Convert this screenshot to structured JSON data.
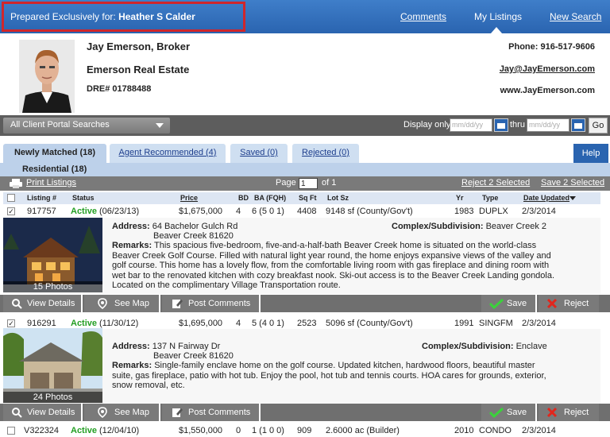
{
  "top": {
    "prepared_label": "Prepared Exclusively for:",
    "client_name": "Heather S Calder",
    "nav": [
      "Comments",
      "My Listings",
      "New Search"
    ]
  },
  "agent": {
    "name": "Jay Emerson, Broker",
    "company": "Emerson Real Estate",
    "dre": "DRE# 01788488",
    "phone": "Phone: 916-517-9606",
    "email": "Jay@JayEmerson.com",
    "website": "www.JayEmerson.com"
  },
  "search": {
    "portal_select": "All Client Portal Searches",
    "display_only_label": "Display only",
    "thru_label": "thru",
    "date_placeholder": "mm/dd/yy",
    "go_label": "Go"
  },
  "tabs": [
    {
      "label": "Newly Matched (18)",
      "active": true
    },
    {
      "label": "Agent Recommended (4)",
      "active": false
    },
    {
      "label": "Saved (0)",
      "active": false
    },
    {
      "label": "Rejected (0)",
      "active": false
    }
  ],
  "help_label": "Help",
  "section_title": "Residential (18)",
  "toolbar": {
    "print_label": "Print Listings",
    "page_label": "Page",
    "page_value": "1",
    "of_label": "of 1",
    "reject_selected": "Reject 2 Selected",
    "save_selected": "Save 2 Selected"
  },
  "columns": [
    "Listing #",
    "Status",
    "Price",
    "BD",
    "BA (FQH)",
    "Sq Ft",
    "Lot Sz",
    "Yr",
    "Type",
    "Date Updated"
  ],
  "listings": [
    {
      "checked": true,
      "listing_no": "917757",
      "status": "Active",
      "status_date": "(06/23/13)",
      "price": "$1,675,000",
      "bd": "4",
      "ba": "6 (5 0 1)",
      "sqft": "4408",
      "lot": "9148 sf (County/Gov't)",
      "yr": "1983",
      "type": "DUPLX",
      "updated": "2/3/2014",
      "photos": "15 Photos",
      "address_label": "Address:",
      "address1": "64 Bachelor Gulch Rd",
      "address2": "Beaver Creek 81620",
      "complex_label": "Complex/Subdivision:",
      "complex": "Beaver Creek 2",
      "remarks_label": "Remarks:",
      "remarks": "This spacious five-bedroom, five-and-a-half-bath Beaver Creek home is situated on the world-class Beaver Creek Golf Course. Filled with natural light year round, the home enjoys expansive views of the valley and golf course. This home has a lovely flow, from the comfortable living room with gas fireplace and dining room with wet bar to the renovated kitchen with cozy breakfast nook. Ski-out access is to the Beaver Creek Landing gondola. Located on the complimentary Village Transportation route."
    },
    {
      "checked": true,
      "listing_no": "916291",
      "status": "Active",
      "status_date": "(11/30/12)",
      "price": "$1,695,000",
      "bd": "4",
      "ba": "5 (4 0 1)",
      "sqft": "2523",
      "lot": "5096 sf (County/Gov't)",
      "yr": "1991",
      "type": "SINGFM",
      "updated": "2/3/2014",
      "photos": "24 Photos",
      "address_label": "Address:",
      "address1": "137 N Fairway Dr",
      "address2": "Beaver Creek 81620",
      "complex_label": "Complex/Subdivision:",
      "complex": "Enclave",
      "remarks_label": "Remarks:",
      "remarks": "Single-family enclave home on the golf course. Updated kitchen, hardwood floors, beautiful master suite, gas fireplace, patio with hot tub. Enjoy the pool, hot tub and tennis courts. HOA cares for grounds, exterior, snow removal, etc."
    },
    {
      "checked": false,
      "listing_no": "V322324",
      "status": "Active",
      "status_date": "(12/04/10)",
      "price": "$1,550,000",
      "bd": "0",
      "ba": "1 (1 0 0)",
      "sqft": "909",
      "lot": "2.6000 ac (Builder)",
      "yr": "2010",
      "type": "CONDO",
      "updated": "2/3/2014"
    }
  ],
  "actions": {
    "view_details": "View Details",
    "see_map": "See Map",
    "post_comments": "Post Comments",
    "save": "Save",
    "reject": "Reject"
  },
  "icons": [
    "printer-icon",
    "magnifier-icon",
    "map-pin-icon",
    "edit-icon",
    "checkmark-icon",
    "x-icon",
    "calendar-icon",
    "chevron-down-icon"
  ]
}
